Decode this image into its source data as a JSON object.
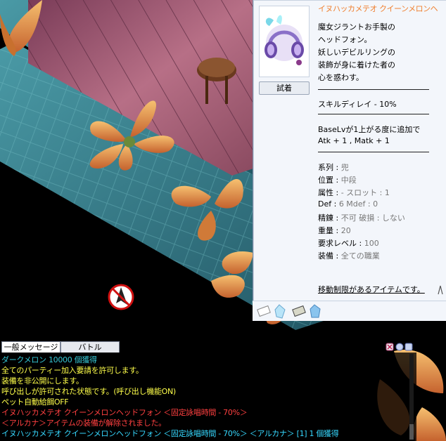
{
  "item": {
    "title": "イヌハッカメテオ クイーンメロンヘ",
    "try_button": "試着",
    "description": [
      "魔女ジラントお手製の",
      "ヘッドフォン。",
      "妖しいデビルリングの",
      "装飾が身に着けた者の",
      "心を惑わす。"
    ],
    "skill_delay": "スキルディレイ - 10%",
    "bonus_lines": [
      "BaseLvが1上がる度に追加で",
      "Atk + 1 , Matk + 1"
    ],
    "stats": [
      {
        "k": "系列 : ",
        "v": "兜"
      },
      {
        "k": "位置 : ",
        "v": "中段"
      },
      {
        "k": "属性 : ",
        "v": "- スロット : 1"
      },
      {
        "k": "Def : ",
        "v": "6 Mdef : 0"
      },
      {
        "k": "精錬 : ",
        "v": "不可 破損 : しない"
      },
      {
        "k": "重量 : ",
        "v": "20"
      },
      {
        "k": "要求レベル : ",
        "v": "100"
      },
      {
        "k": "装備 : ",
        "v": "全ての職業"
      }
    ],
    "restriction_link": "移動制限があるアイテムです。"
  },
  "chat": {
    "tabs": [
      "一般メッセージ",
      "バトル"
    ],
    "lines": [
      {
        "text": "ダークメロン 10000 個獲得",
        "color": "#36c8d6"
      },
      {
        "text": "全てのパーティー加入要請を許可します。",
        "color": "#ffff4a"
      },
      {
        "text": "装備を非公開にします。",
        "color": "#ffff4a"
      },
      {
        "text": "呼び出しが許可された状態です。(呼び出し機能ON)",
        "color": "#ffff4a"
      },
      {
        "text": "ペット自動給餌OFF",
        "color": "#ffff4a"
      },
      {
        "text": "イヌハッカメテオ クイーンメロンヘッドフォン ＜固定詠唱時間 - 70%＞",
        "color": "#ff4040"
      },
      {
        "text": "＜アルカナ＞アイテムの装備が解除されました。",
        "color": "#ff4040"
      },
      {
        "text": "イヌハッカメテオ クイーンメロンヘッドフォン ＜固定詠唱時間 - 70%＞ ＜アルカナ＞ [1] 1 個獲得",
        "color": "#36d8ff"
      }
    ]
  },
  "colors": {
    "title": "#f08030",
    "stat_value": "#777777"
  }
}
